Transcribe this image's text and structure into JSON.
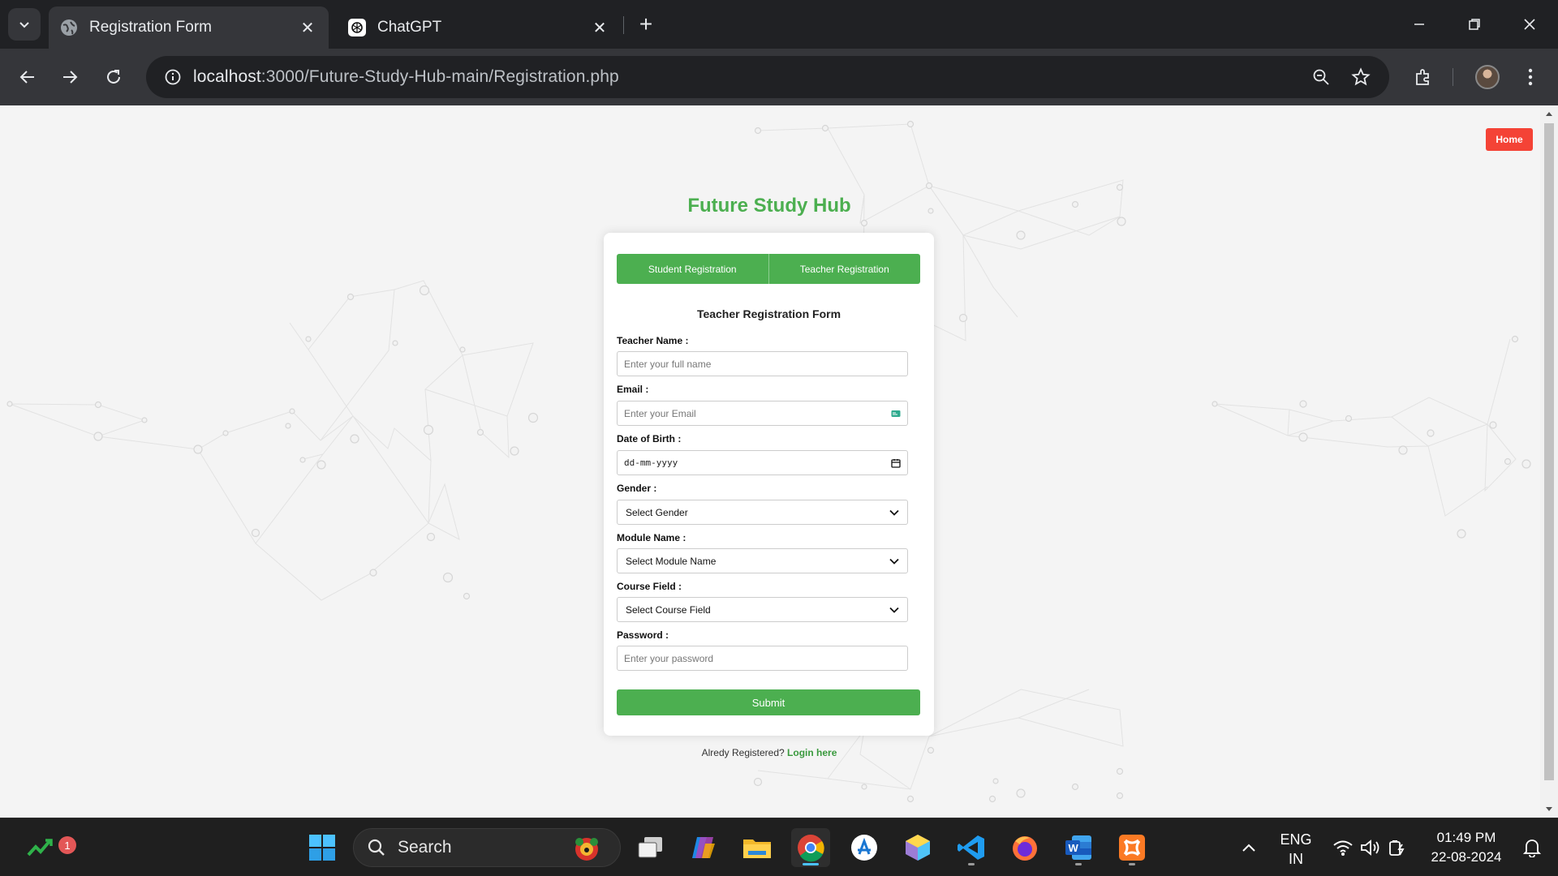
{
  "browser": {
    "tabs": [
      {
        "title": "Registration Form",
        "active": true,
        "icon": "globe-icon"
      },
      {
        "title": "ChatGPT",
        "active": false,
        "icon": "chatgpt-icon"
      }
    ],
    "url_host": "localhost",
    "url_path": ":3000/Future-Study-Hub-main/Registration.php"
  },
  "page": {
    "home_label": "Home",
    "brand": "Future Study Hub",
    "toggle": {
      "student": "Student Registration",
      "teacher": "Teacher Registration"
    },
    "form_title": "Teacher Registration Form",
    "fields": {
      "name_label": "Teacher Name :",
      "name_placeholder": "Enter your full name",
      "email_label": "Email :",
      "email_placeholder": "Enter your Email",
      "dob_label": "Date of Birth :",
      "dob_placeholder": "dd-mm-yyyy",
      "gender_label": "Gender :",
      "gender_value": "Select Gender",
      "module_label": "Module Name :",
      "module_value": "Select Module Name",
      "course_label": "Course Field :",
      "course_value": "Select Course Field",
      "password_label": "Password :",
      "password_placeholder": "Enter your password"
    },
    "submit_label": "Submit",
    "login_prompt": "Alredy Registered?",
    "login_link": "Login here"
  },
  "taskbar": {
    "search_label": "Search",
    "notification_count": "1",
    "lang_line1": "ENG",
    "lang_line2": "IN",
    "time": "01:49 PM",
    "date": "22-08-2024"
  },
  "colors": {
    "accent_green": "#4caf50",
    "home_red": "#f44336"
  }
}
